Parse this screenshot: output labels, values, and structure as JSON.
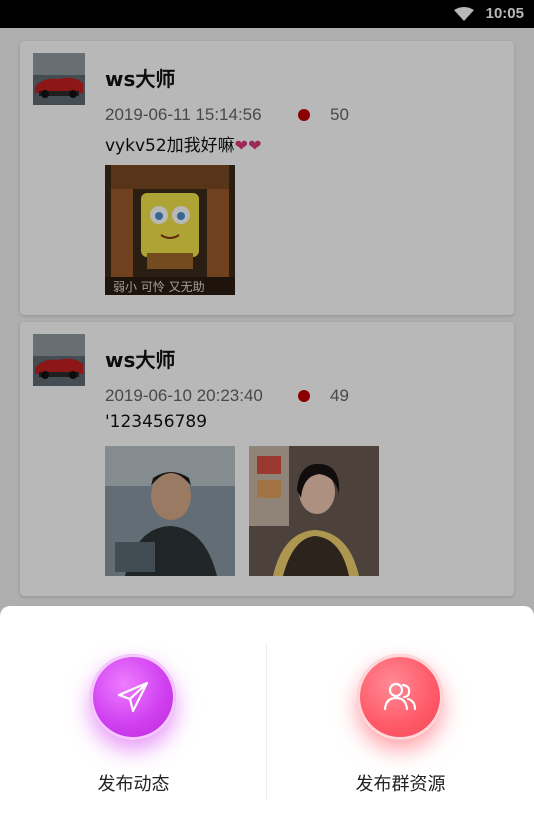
{
  "status_bar": {
    "time": "10:05",
    "wifi_icon": "wifi-icon"
  },
  "posts": [
    {
      "author": "ws大师",
      "timestamp": "2019-06-11 15:14:56",
      "count": "50",
      "text": "vykv52加我好嘛",
      "text_suffix_icons": [
        "heart-icon",
        "heart-icon"
      ],
      "photos": [
        {
          "caption": "弱小 可怜 又无助"
        }
      ]
    },
    {
      "author": "ws大师",
      "timestamp": "2019-06-10 20:23:40",
      "count": "49",
      "text": "'123456789",
      "photos": [
        {
          "caption": ""
        },
        {
          "caption": ""
        }
      ]
    }
  ],
  "bottom_sheet": {
    "actions": [
      {
        "label": "发布动态",
        "icon": "send-plane-icon",
        "color": "#d646f0"
      },
      {
        "label": "发布群资源",
        "icon": "group-users-icon",
        "color": "#ff5666"
      }
    ]
  }
}
